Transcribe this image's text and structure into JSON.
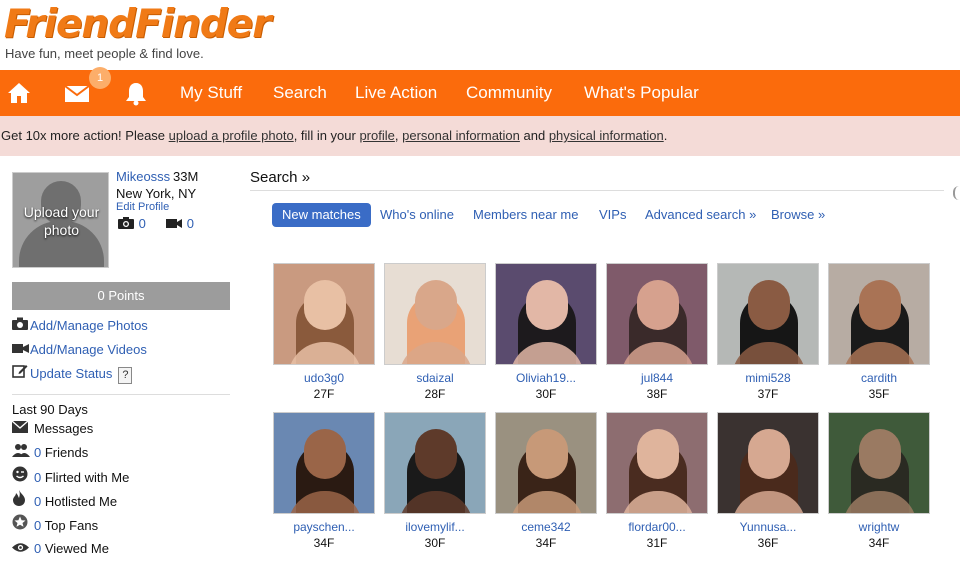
{
  "brand": {
    "logo_text": "FriendFinder",
    "registered_mark": "®",
    "tagline": "Have fun, meet people & find love."
  },
  "nav": {
    "home_icon": "home-icon",
    "mail_icon": "envelope-icon",
    "mail_badge": "1",
    "bell_icon": "bell-icon",
    "items": [
      "My Stuff",
      "Search",
      "Live Action",
      "Community",
      "What's Popular"
    ]
  },
  "notice": {
    "prefix": "Get 10x more action! Please ",
    "link1": "upload a profile photo",
    "sep1": ", fill in your ",
    "link2": "profile",
    "sep2": ", ",
    "link3": "personal information",
    "sep3": " and ",
    "link4": "physical information",
    "suffix": "."
  },
  "profile": {
    "upload_label": "Upload your photo",
    "username": "Mikeosss",
    "age_gender": "33M",
    "location": "New York, NY",
    "edit_label": "Edit Profile",
    "photo_count": "0",
    "video_count": "0",
    "points": "0 Points"
  },
  "sidebar": {
    "links": [
      {
        "icon": "camera-icon",
        "label": "Add/Manage Photos"
      },
      {
        "icon": "video-camera-icon",
        "label": "Add/Manage Videos"
      },
      {
        "icon": "edit-icon",
        "label": "Update Status"
      }
    ],
    "help_label": "?",
    "last90_label": "Last 90 Days",
    "stats": [
      {
        "icon": "envelope-icon",
        "count": "",
        "label": "Messages"
      },
      {
        "icon": "friends-icon",
        "count": "0",
        "label": " Friends"
      },
      {
        "icon": "flirt-icon",
        "count": "0",
        "label": " Flirted with Me"
      },
      {
        "icon": "fire-icon",
        "count": "0",
        "label": " Hotlisted Me"
      },
      {
        "icon": "star-icon",
        "count": "0",
        "label": " Top Fans"
      },
      {
        "icon": "eye-icon",
        "count": "0",
        "label": " Viewed Me"
      }
    ]
  },
  "search": {
    "title": "Search »",
    "tabs": [
      "New matches",
      "Who's online",
      "Members near me",
      "VIPs",
      "Advanced search »",
      "Browse »"
    ],
    "active_tab": "New matches",
    "results": [
      {
        "name": "udo3g0",
        "age": "27F",
        "bg": "#c99a80",
        "skin": "#e8c0a4",
        "hair": "#8a5a3c"
      },
      {
        "name": "sdaizal",
        "age": "28F",
        "bg": "#e7ddd3",
        "skin": "#d9a78a",
        "hair": "#e9a276"
      },
      {
        "name": "Oliviah19...",
        "age": "30F",
        "bg": "#5a4b6e",
        "skin": "#e2b7a6",
        "hair": "#1d1a1d"
      },
      {
        "name": "jul844",
        "age": "38F",
        "bg": "#7f5a6a",
        "skin": "#d6a18e",
        "hair": "#3a2a2a"
      },
      {
        "name": "mimi528",
        "age": "37F",
        "bg": "#b5b8b6",
        "skin": "#8a5b43",
        "hair": "#161616"
      },
      {
        "name": "cardith",
        "age": "35F",
        "bg": "#b7aca3",
        "skin": "#a97355",
        "hair": "#1a1a1a"
      },
      {
        "name": "payschen...",
        "age": "34F",
        "bg": "#6a88b2",
        "skin": "#9a6548",
        "hair": "#2a1a12"
      },
      {
        "name": "ilovemylif...",
        "age": "30F",
        "bg": "#8aa6b8",
        "skin": "#5e3a2a",
        "hair": "#1a1a1a"
      },
      {
        "name": "ceme342",
        "age": "34F",
        "bg": "#9a9180",
        "skin": "#c79978",
        "hair": "#3a2418"
      },
      {
        "name": "flordar00...",
        "age": "31F",
        "bg": "#8d6d70",
        "skin": "#dfb49c",
        "hair": "#4a2c20"
      },
      {
        "name": "Yunnusa...",
        "age": "36F",
        "bg": "#3a3230",
        "skin": "#d6a891",
        "hair": "#4a2a1c"
      },
      {
        "name": "wrightw",
        "age": "34F",
        "bg": "#3f5a3a",
        "skin": "#9a7a62",
        "hair": "#2a2a22"
      }
    ]
  },
  "colors": {
    "brand_orange": "#fb6b0c",
    "link_blue": "#2f5fb3",
    "active_tab": "#3a6cc6",
    "notice_bg": "#f4dbd7",
    "points_bg": "#9c9c9c"
  }
}
